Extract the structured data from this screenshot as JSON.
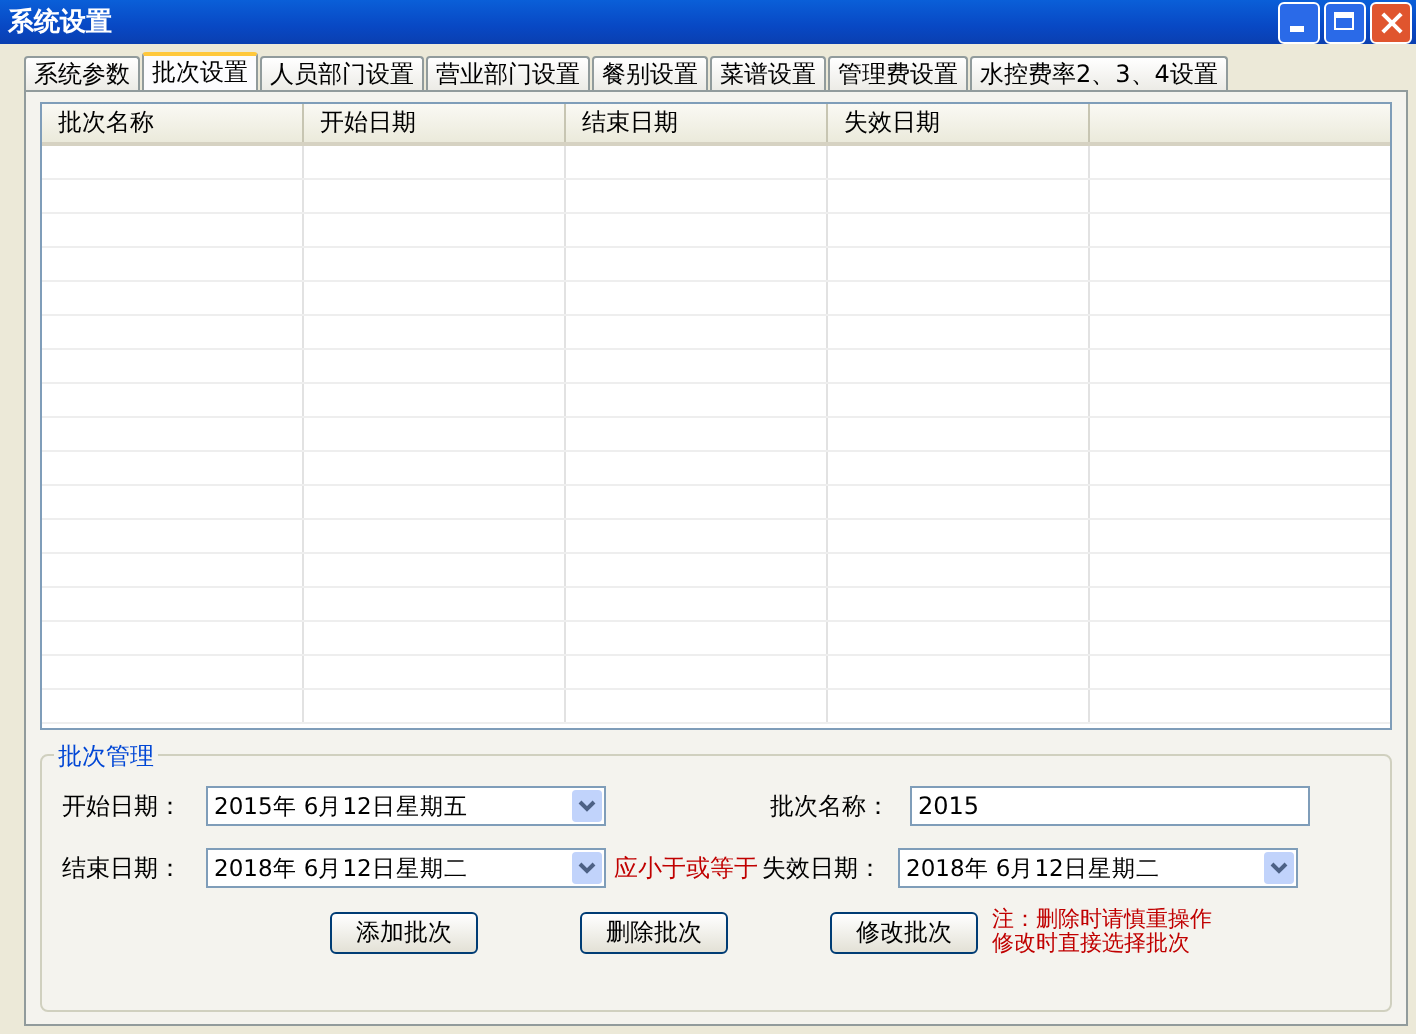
{
  "window": {
    "title": "系统设置"
  },
  "tabs": [
    {
      "label": "系统参数",
      "selected": false
    },
    {
      "label": "批次设置",
      "selected": true
    },
    {
      "label": "人员部门设置",
      "selected": false
    },
    {
      "label": "营业部门设置",
      "selected": false
    },
    {
      "label": "餐别设置",
      "selected": false
    },
    {
      "label": "菜谱设置",
      "selected": false
    },
    {
      "label": "管理费设置",
      "selected": false
    },
    {
      "label": "水控费率2、3、4设置",
      "selected": false
    }
  ],
  "table": {
    "columns": [
      "批次名称",
      "开始日期",
      "结束日期",
      "失效日期"
    ]
  },
  "batch_group": {
    "title": "批次管理",
    "start_date": {
      "label": "开始日期：",
      "value": "2015年  6月12日星期五"
    },
    "end_date": {
      "label": "结束日期：",
      "value": "2018年  6月12日星期二"
    },
    "hint": "应小于或等于",
    "batch_name": {
      "label": "批次名称：",
      "value": "2015"
    },
    "expiry_date": {
      "label": "失效日期：",
      "value": "2018年  6月12日星期二"
    },
    "buttons": [
      "添加批次",
      "删除批次",
      "修改批次"
    ],
    "note": [
      "注：删除时请慎重操作",
      "修改时直接选择批次"
    ]
  }
}
